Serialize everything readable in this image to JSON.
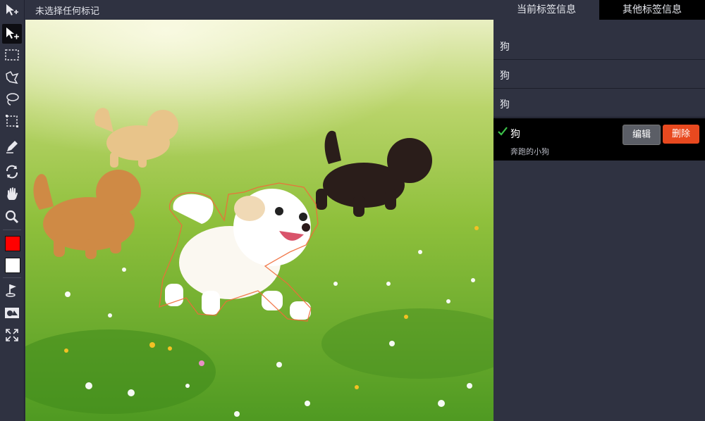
{
  "status": {
    "selection_text": "未选择任何标记"
  },
  "tabs": [
    {
      "label": "当前标签信息"
    },
    {
      "label": "其他标签信息"
    }
  ],
  "labels": [
    {
      "name": "狗"
    },
    {
      "name": "狗"
    },
    {
      "name": "狗"
    }
  ],
  "selected_label": {
    "name": "狗",
    "description": "奔跑的小狗",
    "edit_label": "编辑",
    "delete_label": "删除"
  },
  "colors": {
    "primary_swatch": "#ff0000",
    "secondary_swatch": "#ffffff",
    "delete_button": "#e8491f",
    "check": "#3cc24a"
  },
  "toolbar": {
    "tools": [
      "move-select-icon",
      "pointer-add-icon",
      "rect-select-icon",
      "polygon-select-icon",
      "lasso-icon",
      "marquee-icon",
      "pen-icon",
      "rotate-icon",
      "hand-icon",
      "zoom-icon",
      "primary-color-swatch",
      "secondary-color-swatch",
      "flag-icon",
      "shapes-icon",
      "fullscreen-icon"
    ]
  }
}
